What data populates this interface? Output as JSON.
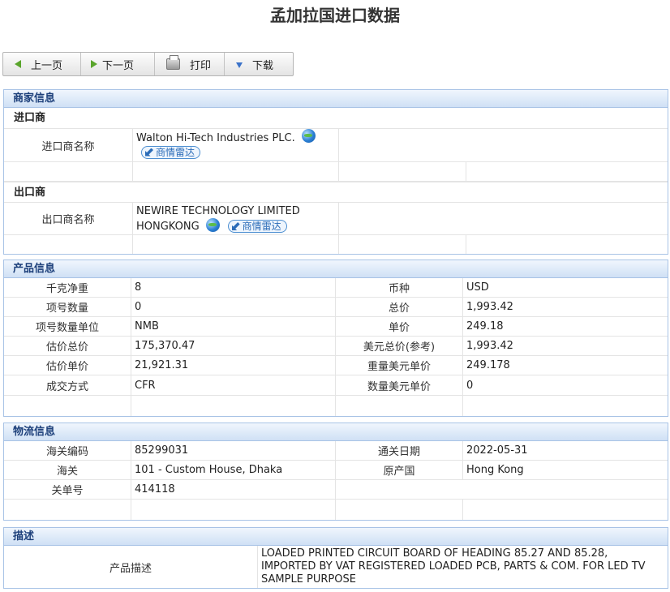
{
  "page_title": "孟加拉国进口数据",
  "toolbar": {
    "prev": "上一页",
    "next": "下一页",
    "print": "打印",
    "download": "下载"
  },
  "merchant": {
    "header": "商家信息",
    "importer": {
      "subheader": "进口商",
      "name_label": "进口商名称",
      "name": "Walton Hi-Tech Industries PLC.",
      "radar_label": "商情雷达"
    },
    "exporter": {
      "subheader": "出口商",
      "name_label": "出口商名称",
      "name_line1": "NEWIRE TECHNOLOGY LIMITED",
      "name_line2": "HONGKONG",
      "radar_label": "商情雷达"
    }
  },
  "product": {
    "header": "产品信息",
    "rows": [
      {
        "l1": "千克净重",
        "v1": "8",
        "l2": "币种",
        "v2": "USD"
      },
      {
        "l1": "项号数量",
        "v1": "0",
        "l2": "总价",
        "v2": "1,993.42"
      },
      {
        "l1": "项号数量单位",
        "v1": "NMB",
        "l2": "单价",
        "v2": "249.18"
      },
      {
        "l1": "估价总价",
        "v1": "175,370.47",
        "l2": "美元总价(参考)",
        "v2": "1,993.42"
      },
      {
        "l1": "估价单价",
        "v1": "21,921.31",
        "l2": "重量美元单价",
        "v2": "249.178"
      },
      {
        "l1": "成交方式",
        "v1": "CFR",
        "l2": "数量美元单价",
        "v2": "0"
      }
    ]
  },
  "logistics": {
    "header": "物流信息",
    "rows": [
      {
        "l1": "海关编码",
        "v1": "85299031",
        "l2": "通关日期",
        "v2": "2022-05-31"
      },
      {
        "l1": "海关",
        "v1": "101 - Custom House, Dhaka",
        "l2": "原产国",
        "v2": "Hong Kong"
      },
      {
        "l1": "关单号",
        "v1": "414118",
        "l2": "",
        "v2": ""
      }
    ]
  },
  "description": {
    "header": "描述",
    "label": "产品描述",
    "text": "LOADED PRINTED CIRCUIT BOARD OF HEADING 85.27 AND 85.28, IMPORTED BY VAT REGISTERED LOADED PCB, PARTS & COM. FOR LED TV SAMPLE PURPOSE"
  }
}
